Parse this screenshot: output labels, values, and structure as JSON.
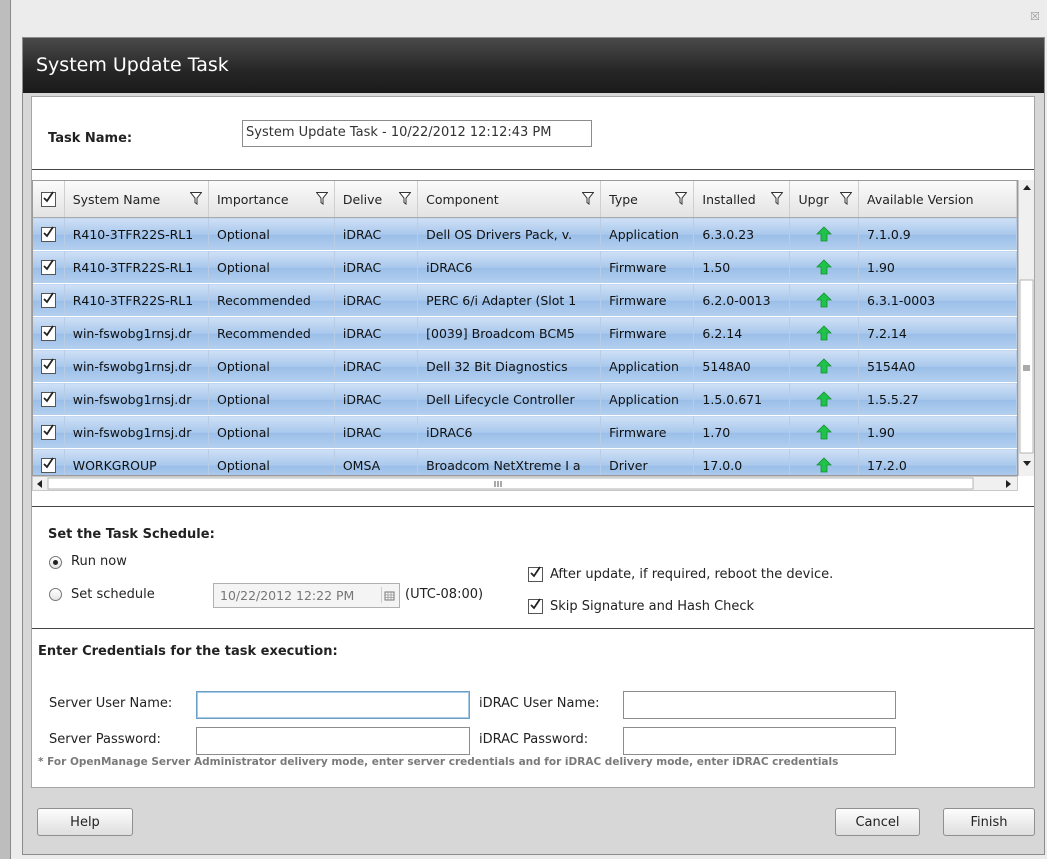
{
  "window": {
    "close_glyph": "☒"
  },
  "dialog": {
    "title": "System Update Task"
  },
  "task": {
    "label": "Task Name:",
    "value": "System Update Task - 10/22/2012 12:12:43 PM"
  },
  "grid": {
    "columns": [
      "System Name",
      "Importance",
      "Delive",
      "Component",
      "Type",
      "Installed",
      "Upgr",
      "Available Version"
    ],
    "rows": [
      {
        "system": "R410-3TFR22S-RL1",
        "importance": "Optional",
        "delivery": "iDRAC",
        "component": "Dell OS Drivers Pack, v.",
        "type": "Application",
        "installed": "6.3.0.23",
        "available": "7.1.0.9"
      },
      {
        "system": "R410-3TFR22S-RL1",
        "importance": "Optional",
        "delivery": "iDRAC",
        "component": "iDRAC6",
        "type": "Firmware",
        "installed": "1.50",
        "available": "1.90"
      },
      {
        "system": "R410-3TFR22S-RL1",
        "importance": "Recommended",
        "delivery": "iDRAC",
        "component": "PERC 6/i Adapter (Slot 1",
        "type": "Firmware",
        "installed": "6.2.0-0013",
        "available": "6.3.1-0003"
      },
      {
        "system": "win-fswobg1rnsj.dr",
        "importance": "Recommended",
        "delivery": "iDRAC",
        "component": "[0039] Broadcom BCM5",
        "type": "Firmware",
        "installed": "6.2.14",
        "available": "7.2.14"
      },
      {
        "system": "win-fswobg1rnsj.dr",
        "importance": "Optional",
        "delivery": "iDRAC",
        "component": "Dell 32 Bit Diagnostics",
        "type": "Application",
        "installed": "5148A0",
        "available": "5154A0"
      },
      {
        "system": "win-fswobg1rnsj.dr",
        "importance": "Optional",
        "delivery": "iDRAC",
        "component": "Dell Lifecycle Controller",
        "type": "Application",
        "installed": "1.5.0.671",
        "available": "1.5.5.27"
      },
      {
        "system": "win-fswobg1rnsj.dr",
        "importance": "Optional",
        "delivery": "iDRAC",
        "component": "iDRAC6",
        "type": "Firmware",
        "installed": "1.70",
        "available": "1.90"
      },
      {
        "system": "WORKGROUP",
        "importance": "Optional",
        "delivery": "OMSA",
        "component": "Broadcom NetXtreme I a",
        "type": "Driver",
        "installed": "17.0.0",
        "available": "17.2.0"
      }
    ],
    "icons": {
      "filter": "filter-icon",
      "upgrade": "upgrade-arrow-icon",
      "checkbox": "checkmark-icon"
    },
    "colors": {
      "row": "#a9c8ec",
      "upgrade_arrow": "#1fc24a"
    }
  },
  "schedule": {
    "title": "Set the Task Schedule:",
    "run_now": "Run now",
    "set_schedule": "Set schedule",
    "date_value": "10/22/2012 12:22 PM",
    "timezone": "(UTC-08:00)",
    "reboot_label": "After update, if required, reboot the device.",
    "skip_label": "Skip Signature and Hash Check"
  },
  "credentials": {
    "title": "Enter Credentials for the task execution:",
    "server_user_label": "Server User Name:",
    "server_password_label": "Server Password:",
    "idrac_user_label": "iDRAC User Name:",
    "idrac_password_label": "iDRAC Password:",
    "note": "* For OpenManage Server Administrator delivery mode, enter server credentials and for iDRAC delivery mode, enter iDRAC credentials"
  },
  "footer": {
    "help": "Help",
    "cancel": "Cancel",
    "finish": "Finish"
  }
}
